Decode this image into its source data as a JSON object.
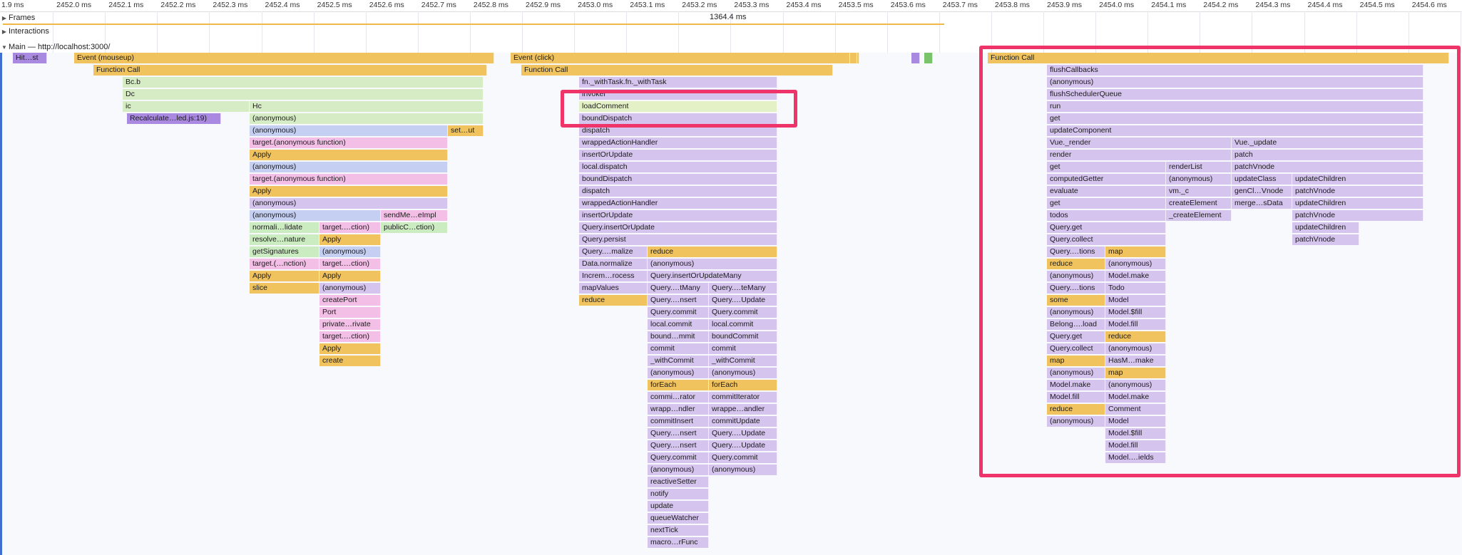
{
  "ruler": {
    "ticks": [
      "1.9 ms",
      "2452.0 ms",
      "2452.1 ms",
      "2452.2 ms",
      "2452.3 ms",
      "2452.4 ms",
      "2452.5 ms",
      "2452.6 ms",
      "2452.7 ms",
      "2452.8 ms",
      "2452.9 ms",
      "2453.0 ms",
      "2453.1 ms",
      "2453.2 ms",
      "2453.3 ms",
      "2453.4 ms",
      "2453.5 ms",
      "2453.6 ms",
      "2453.7 ms",
      "2453.8 ms",
      "2453.9 ms",
      "2454.0 ms",
      "2454.1 ms",
      "2454.2 ms",
      "2454.3 ms",
      "2454.4 ms",
      "2454.5 ms",
      "2454.6 ms",
      "24"
    ]
  },
  "tracks": {
    "frames": "Frames",
    "interactions": "Interactions",
    "main": "Main — http://localhost:3000/",
    "total": "1364.4 ms"
  },
  "colors": {
    "yellow": "#f0c35e",
    "green": "#d6ecc4",
    "purple": "#d5c4ee",
    "dark_purple": "#a98ae0",
    "pink": "#f3bfe6",
    "blue": "#c4cff2",
    "highlight": "#ee3468"
  },
  "flame": [
    {
      "row": 0,
      "s": 18,
      "e": 66,
      "c": "dp",
      "t": "Hit…st"
    },
    {
      "row": 0,
      "s": 104,
      "e": 693,
      "c": "y",
      "t": "Event (mouseup)"
    },
    {
      "row": 1,
      "s": 131,
      "e": 683,
      "c": "y",
      "t": "Function Call"
    },
    {
      "row": 2,
      "s": 172,
      "e": 678,
      "c": "g",
      "t": "Bc.b"
    },
    {
      "row": 3,
      "s": 172,
      "e": 678,
      "c": "g",
      "t": "Dc"
    },
    {
      "row": 4,
      "s": 172,
      "e": 350,
      "c": "g",
      "t": "ic"
    },
    {
      "row": 4,
      "s": 350,
      "e": 678,
      "c": "g",
      "t": "Hc"
    },
    {
      "row": 5,
      "s": 178,
      "e": 310,
      "c": "dp",
      "t": "Recalculate…led.js:19)"
    },
    {
      "row": 5,
      "s": 350,
      "e": 678,
      "c": "g",
      "t": "(anonymous)"
    },
    {
      "row": 6,
      "s": 350,
      "e": 628,
      "c": "b",
      "t": "(anonymous)"
    },
    {
      "row": 6,
      "s": 628,
      "e": 678,
      "c": "y",
      "t": "set…ut"
    },
    {
      "row": 7,
      "s": 350,
      "e": 628,
      "c": "pk",
      "t": "target.(anonymous function)"
    },
    {
      "row": 8,
      "s": 350,
      "e": 628,
      "c": "y",
      "t": "Apply"
    },
    {
      "row": 9,
      "s": 350,
      "e": 628,
      "c": "b",
      "t": "(anonymous)"
    },
    {
      "row": 10,
      "s": 350,
      "e": 628,
      "c": "pk",
      "t": "target.(anonymous function)"
    },
    {
      "row": 11,
      "s": 350,
      "e": 628,
      "c": "y",
      "t": "Apply"
    },
    {
      "row": 12,
      "s": 350,
      "e": 628,
      "c": "p",
      "t": "(anonymous)"
    },
    {
      "row": 13,
      "s": 350,
      "e": 534,
      "c": "b",
      "t": "(anonymous)"
    },
    {
      "row": 13,
      "s": 534,
      "e": 628,
      "c": "pk",
      "t": "sendMe…eImpl"
    },
    {
      "row": 14,
      "s": 350,
      "e": 448,
      "c": "lg",
      "t": "normali…lidate"
    },
    {
      "row": 14,
      "s": 448,
      "e": 534,
      "c": "pk",
      "t": "target.…ction)"
    },
    {
      "row": 14,
      "s": 534,
      "e": 628,
      "c": "lg",
      "t": "publicC…ction)"
    },
    {
      "row": 15,
      "s": 350,
      "e": 448,
      "c": "lg",
      "t": "resolve…nature"
    },
    {
      "row": 15,
      "s": 448,
      "e": 534,
      "c": "y",
      "t": "Apply"
    },
    {
      "row": 16,
      "s": 350,
      "e": 448,
      "c": "lg",
      "t": "getSignatures"
    },
    {
      "row": 16,
      "s": 448,
      "e": 534,
      "c": "b",
      "t": "(anonymous)"
    },
    {
      "row": 17,
      "s": 350,
      "e": 448,
      "c": "pk",
      "t": "target.(…nction)"
    },
    {
      "row": 17,
      "s": 448,
      "e": 534,
      "c": "pk",
      "t": "target.…ction)"
    },
    {
      "row": 18,
      "s": 350,
      "e": 448,
      "c": "y",
      "t": "Apply"
    },
    {
      "row": 18,
      "s": 448,
      "e": 534,
      "c": "y",
      "t": "Apply"
    },
    {
      "row": 19,
      "s": 350,
      "e": 448,
      "c": "y",
      "t": "slice"
    },
    {
      "row": 19,
      "s": 448,
      "e": 534,
      "c": "p",
      "t": "(anonymous)"
    },
    {
      "row": 20,
      "s": 448,
      "e": 534,
      "c": "pk",
      "t": "createPort"
    },
    {
      "row": 21,
      "s": 448,
      "e": 534,
      "c": "pk",
      "t": "Port"
    },
    {
      "row": 22,
      "s": 448,
      "e": 534,
      "c": "pk",
      "t": "private…rivate"
    },
    {
      "row": 23,
      "s": 448,
      "e": 534,
      "c": "pk",
      "t": "target.…ction)"
    },
    {
      "row": 24,
      "s": 448,
      "e": 534,
      "c": "y",
      "t": "Apply"
    },
    {
      "row": 25,
      "s": 448,
      "e": 534,
      "c": "y",
      "t": "create"
    },
    {
      "row": 0,
      "s": 716,
      "e": 1205,
      "c": "y",
      "t": "Event (click)"
    },
    {
      "row": 1,
      "s": 731,
      "e": 1168,
      "c": "y",
      "t": "Function Call"
    },
    {
      "row": 2,
      "s": 812,
      "e": 1090,
      "c": "p",
      "t": "fn._withTask.fn._withTask"
    },
    {
      "row": 3,
      "s": 812,
      "e": 1090,
      "c": "p",
      "t": "invoker"
    },
    {
      "row": 4,
      "s": 812,
      "e": 1090,
      "c": "hl",
      "t": "loadComment"
    },
    {
      "row": 5,
      "s": 812,
      "e": 1090,
      "c": "p",
      "t": "boundDispatch"
    },
    {
      "row": 6,
      "s": 812,
      "e": 1090,
      "c": "p",
      "t": "dispatch"
    },
    {
      "row": 7,
      "s": 812,
      "e": 1090,
      "c": "p",
      "t": "wrappedActionHandler"
    },
    {
      "row": 8,
      "s": 812,
      "e": 1090,
      "c": "p",
      "t": "insertOrUpdate"
    },
    {
      "row": 9,
      "s": 812,
      "e": 1090,
      "c": "p",
      "t": "local.dispatch"
    },
    {
      "row": 10,
      "s": 812,
      "e": 1090,
      "c": "p",
      "t": "boundDispatch"
    },
    {
      "row": 11,
      "s": 812,
      "e": 1090,
      "c": "p",
      "t": "dispatch"
    },
    {
      "row": 12,
      "s": 812,
      "e": 1090,
      "c": "p",
      "t": "wrappedActionHandler"
    },
    {
      "row": 13,
      "s": 812,
      "e": 1090,
      "c": "p",
      "t": "insertOrUpdate"
    },
    {
      "row": 14,
      "s": 812,
      "e": 1090,
      "c": "p",
      "t": "Query.insertOrUpdate"
    },
    {
      "row": 15,
      "s": 812,
      "e": 1090,
      "c": "p",
      "t": "Query.persist"
    },
    {
      "row": 16,
      "s": 812,
      "e": 908,
      "c": "p",
      "t": "Query.…malize"
    },
    {
      "row": 16,
      "s": 908,
      "e": 1090,
      "c": "y",
      "t": "reduce"
    },
    {
      "row": 17,
      "s": 812,
      "e": 908,
      "c": "p",
      "t": "Data.normalize"
    },
    {
      "row": 17,
      "s": 908,
      "e": 1090,
      "c": "p",
      "t": "(anonymous)"
    },
    {
      "row": 18,
      "s": 812,
      "e": 908,
      "c": "p",
      "t": "Increm…rocess"
    },
    {
      "row": 18,
      "s": 908,
      "e": 1090,
      "c": "p",
      "t": "Query.insertOrUpdateMany"
    },
    {
      "row": 19,
      "s": 812,
      "e": 908,
      "c": "p",
      "t": "mapValues"
    },
    {
      "row": 19,
      "s": 908,
      "e": 994,
      "c": "p",
      "t": "Query.…tMany"
    },
    {
      "row": 19,
      "s": 994,
      "e": 1090,
      "c": "p",
      "t": "Query.…teMany"
    },
    {
      "row": 20,
      "s": 812,
      "e": 908,
      "c": "y",
      "t": "reduce"
    },
    {
      "row": 20,
      "s": 908,
      "e": 994,
      "c": "p",
      "t": "Query.…nsert"
    },
    {
      "row": 20,
      "s": 994,
      "e": 1090,
      "c": "p",
      "t": "Query.…Update"
    },
    {
      "row": 21,
      "s": 908,
      "e": 994,
      "c": "p",
      "t": "Query.commit"
    },
    {
      "row": 21,
      "s": 994,
      "e": 1090,
      "c": "p",
      "t": "Query.commit"
    },
    {
      "row": 22,
      "s": 908,
      "e": 994,
      "c": "p",
      "t": "local.commit"
    },
    {
      "row": 22,
      "s": 994,
      "e": 1090,
      "c": "p",
      "t": "local.commit"
    },
    {
      "row": 23,
      "s": 908,
      "e": 994,
      "c": "p",
      "t": "bound…mmit"
    },
    {
      "row": 23,
      "s": 994,
      "e": 1090,
      "c": "p",
      "t": "boundCommit"
    },
    {
      "row": 24,
      "s": 908,
      "e": 994,
      "c": "p",
      "t": "commit"
    },
    {
      "row": 24,
      "s": 994,
      "e": 1090,
      "c": "p",
      "t": "commit"
    },
    {
      "row": 25,
      "s": 908,
      "e": 994,
      "c": "p",
      "t": "_withCommit"
    },
    {
      "row": 25,
      "s": 994,
      "e": 1090,
      "c": "p",
      "t": "_withCommit"
    },
    {
      "row": 26,
      "s": 908,
      "e": 994,
      "c": "p",
      "t": "(anonymous)"
    },
    {
      "row": 26,
      "s": 994,
      "e": 1090,
      "c": "p",
      "t": "(anonymous)"
    },
    {
      "row": 27,
      "s": 908,
      "e": 994,
      "c": "y",
      "t": "forEach"
    },
    {
      "row": 27,
      "s": 994,
      "e": 1090,
      "c": "y",
      "t": "forEach"
    },
    {
      "row": 28,
      "s": 908,
      "e": 994,
      "c": "p",
      "t": "commi…rator"
    },
    {
      "row": 28,
      "s": 994,
      "e": 1090,
      "c": "p",
      "t": "commitIterator"
    },
    {
      "row": 29,
      "s": 908,
      "e": 994,
      "c": "p",
      "t": "wrapp…ndler"
    },
    {
      "row": 29,
      "s": 994,
      "e": 1090,
      "c": "p",
      "t": "wrappe…andler"
    },
    {
      "row": 30,
      "s": 908,
      "e": 994,
      "c": "p",
      "t": "commitInsert"
    },
    {
      "row": 30,
      "s": 994,
      "e": 1090,
      "c": "p",
      "t": "commitUpdate"
    },
    {
      "row": 31,
      "s": 908,
      "e": 994,
      "c": "p",
      "t": "Query.…nsert"
    },
    {
      "row": 31,
      "s": 994,
      "e": 1090,
      "c": "p",
      "t": "Query.…Update"
    },
    {
      "row": 32,
      "s": 908,
      "e": 994,
      "c": "p",
      "t": "Query.…nsert"
    },
    {
      "row": 32,
      "s": 994,
      "e": 1090,
      "c": "p",
      "t": "Query.…Update"
    },
    {
      "row": 33,
      "s": 908,
      "e": 994,
      "c": "p",
      "t": "Query.commit"
    },
    {
      "row": 33,
      "s": 994,
      "e": 1090,
      "c": "p",
      "t": "Query.commit"
    },
    {
      "row": 34,
      "s": 908,
      "e": 994,
      "c": "p",
      "t": "(anonymous)"
    },
    {
      "row": 34,
      "s": 994,
      "e": 1090,
      "c": "p",
      "t": "(anonymous)"
    },
    {
      "row": 35,
      "s": 908,
      "e": 994,
      "c": "p",
      "t": "reactiveSetter"
    },
    {
      "row": 36,
      "s": 908,
      "e": 994,
      "c": "p",
      "t": "notify"
    },
    {
      "row": 37,
      "s": 908,
      "e": 994,
      "c": "p",
      "t": "update"
    },
    {
      "row": 38,
      "s": 908,
      "e": 994,
      "c": "p",
      "t": "queueWatcher"
    },
    {
      "row": 39,
      "s": 908,
      "e": 994,
      "c": "p",
      "t": "nextTick"
    },
    {
      "row": 40,
      "s": 908,
      "e": 994,
      "c": "p",
      "t": "macro…rFunc"
    },
    {
      "row": 0,
      "s": 1278,
      "e": 1290,
      "c": "dp",
      "t": ""
    },
    {
      "row": 0,
      "s": 1296,
      "e": 1308,
      "c": "gr",
      "t": ""
    },
    {
      "row": 0,
      "s": 1188,
      "e": 1192,
      "c": "y",
      "t": ""
    },
    {
      "row": 0,
      "s": 1198,
      "e": 1202,
      "c": "y",
      "t": ""
    },
    {
      "row": 0,
      "s": 1385,
      "e": 2032,
      "c": "y",
      "t": "Function Call"
    },
    {
      "row": 1,
      "s": 1468,
      "e": 1996,
      "c": "p",
      "t": "flushCallbacks"
    },
    {
      "row": 2,
      "s": 1468,
      "e": 1996,
      "c": "p",
      "t": "(anonymous)"
    },
    {
      "row": 3,
      "s": 1468,
      "e": 1996,
      "c": "p",
      "t": "flushSchedulerQueue"
    },
    {
      "row": 4,
      "s": 1468,
      "e": 1996,
      "c": "p",
      "t": "run"
    },
    {
      "row": 5,
      "s": 1468,
      "e": 1996,
      "c": "p",
      "t": "get"
    },
    {
      "row": 6,
      "s": 1468,
      "e": 1996,
      "c": "p",
      "t": "updateComponent"
    },
    {
      "row": 7,
      "s": 1468,
      "e": 1727,
      "c": "p",
      "t": "Vue._render"
    },
    {
      "row": 7,
      "s": 1727,
      "e": 1996,
      "c": "p",
      "t": "Vue._update"
    },
    {
      "row": 8,
      "s": 1468,
      "e": 1727,
      "c": "p",
      "t": "render"
    },
    {
      "row": 8,
      "s": 1727,
      "e": 1996,
      "c": "p",
      "t": "patch"
    },
    {
      "row": 9,
      "s": 1468,
      "e": 1635,
      "c": "p",
      "t": "get"
    },
    {
      "row": 9,
      "s": 1635,
      "e": 1727,
      "c": "p",
      "t": "renderList"
    },
    {
      "row": 9,
      "s": 1727,
      "e": 1996,
      "c": "p",
      "t": "patchVnode"
    },
    {
      "row": 10,
      "s": 1468,
      "e": 1635,
      "c": "p",
      "t": "computedGetter"
    },
    {
      "row": 10,
      "s": 1635,
      "e": 1727,
      "c": "p",
      "t": "(anonymous)"
    },
    {
      "row": 10,
      "s": 1727,
      "e": 1812,
      "c": "p",
      "t": "updateClass"
    },
    {
      "row": 10,
      "s": 1812,
      "e": 1996,
      "c": "p",
      "t": "updateChildren"
    },
    {
      "row": 11,
      "s": 1468,
      "e": 1635,
      "c": "p",
      "t": "evaluate"
    },
    {
      "row": 11,
      "s": 1635,
      "e": 1727,
      "c": "p",
      "t": "vm._c"
    },
    {
      "row": 11,
      "s": 1727,
      "e": 1812,
      "c": "p",
      "t": "genCl…Vnode"
    },
    {
      "row": 11,
      "s": 1812,
      "e": 1996,
      "c": "p",
      "t": "patchVnode"
    },
    {
      "row": 12,
      "s": 1468,
      "e": 1635,
      "c": "p",
      "t": "get"
    },
    {
      "row": 12,
      "s": 1635,
      "e": 1727,
      "c": "p",
      "t": "createElement"
    },
    {
      "row": 12,
      "s": 1727,
      "e": 1812,
      "c": "p",
      "t": "merge…sData"
    },
    {
      "row": 12,
      "s": 1812,
      "e": 1996,
      "c": "p",
      "t": "updateChildren"
    },
    {
      "row": 13,
      "s": 1468,
      "e": 1635,
      "c": "p",
      "t": "todos"
    },
    {
      "row": 13,
      "s": 1635,
      "e": 1727,
      "c": "p",
      "t": "_createElement"
    },
    {
      "row": 13,
      "s": 1812,
      "e": 1996,
      "c": "p",
      "t": "patchVnode"
    },
    {
      "row": 14,
      "s": 1468,
      "e": 1635,
      "c": "p",
      "t": "Query.get"
    },
    {
      "row": 14,
      "s": 1812,
      "e": 1906,
      "c": "p",
      "t": "updateChildren"
    },
    {
      "row": 15,
      "s": 1468,
      "e": 1635,
      "c": "p",
      "t": "Query.collect"
    },
    {
      "row": 15,
      "s": 1812,
      "e": 1906,
      "c": "p",
      "t": "patchVnode"
    },
    {
      "row": 16,
      "s": 1468,
      "e": 1550,
      "c": "p",
      "t": "Query.…tions"
    },
    {
      "row": 16,
      "s": 1550,
      "e": 1635,
      "c": "y",
      "t": "map"
    },
    {
      "row": 17,
      "s": 1468,
      "e": 1550,
      "c": "y",
      "t": "reduce"
    },
    {
      "row": 17,
      "s": 1550,
      "e": 1635,
      "c": "p",
      "t": "(anonymous)"
    },
    {
      "row": 18,
      "s": 1468,
      "e": 1550,
      "c": "p",
      "t": "(anonymous)"
    },
    {
      "row": 18,
      "s": 1550,
      "e": 1635,
      "c": "p",
      "t": "Model.make"
    },
    {
      "row": 19,
      "s": 1468,
      "e": 1550,
      "c": "p",
      "t": "Query.…tions"
    },
    {
      "row": 19,
      "s": 1550,
      "e": 1635,
      "c": "p",
      "t": "Todo"
    },
    {
      "row": 20,
      "s": 1468,
      "e": 1550,
      "c": "y",
      "t": "some"
    },
    {
      "row": 20,
      "s": 1550,
      "e": 1635,
      "c": "p",
      "t": "Model"
    },
    {
      "row": 21,
      "s": 1468,
      "e": 1550,
      "c": "p",
      "t": "(anonymous)"
    },
    {
      "row": 21,
      "s": 1550,
      "e": 1635,
      "c": "p",
      "t": "Model.$fill"
    },
    {
      "row": 22,
      "s": 1468,
      "e": 1550,
      "c": "p",
      "t": "Belong….load"
    },
    {
      "row": 22,
      "s": 1550,
      "e": 1635,
      "c": "p",
      "t": "Model.fill"
    },
    {
      "row": 23,
      "s": 1468,
      "e": 1550,
      "c": "p",
      "t": "Query.get"
    },
    {
      "row": 23,
      "s": 1550,
      "e": 1635,
      "c": "y",
      "t": "reduce"
    },
    {
      "row": 24,
      "s": 1468,
      "e": 1550,
      "c": "p",
      "t": "Query.collect"
    },
    {
      "row": 24,
      "s": 1550,
      "e": 1635,
      "c": "p",
      "t": "(anonymous)"
    },
    {
      "row": 25,
      "s": 1468,
      "e": 1550,
      "c": "y",
      "t": "map"
    },
    {
      "row": 25,
      "s": 1550,
      "e": 1635,
      "c": "p",
      "t": "HasM…make"
    },
    {
      "row": 26,
      "s": 1468,
      "e": 1550,
      "c": "p",
      "t": "(anonymous)"
    },
    {
      "row": 26,
      "s": 1550,
      "e": 1635,
      "c": "y",
      "t": "map"
    },
    {
      "row": 27,
      "s": 1468,
      "e": 1550,
      "c": "p",
      "t": "Model.make"
    },
    {
      "row": 27,
      "s": 1550,
      "e": 1635,
      "c": "p",
      "t": "(anonymous)"
    },
    {
      "row": 28,
      "s": 1468,
      "e": 1550,
      "c": "p",
      "t": "Model.fill"
    },
    {
      "row": 28,
      "s": 1550,
      "e": 1635,
      "c": "p",
      "t": "Model.make"
    },
    {
      "row": 29,
      "s": 1468,
      "e": 1550,
      "c": "y",
      "t": "reduce"
    },
    {
      "row": 29,
      "s": 1550,
      "e": 1635,
      "c": "p",
      "t": "Comment"
    },
    {
      "row": 30,
      "s": 1468,
      "e": 1550,
      "c": "p",
      "t": "(anonymous)"
    },
    {
      "row": 30,
      "s": 1550,
      "e": 1635,
      "c": "p",
      "t": "Model"
    },
    {
      "row": 31,
      "s": 1550,
      "e": 1635,
      "c": "p",
      "t": "Model.$fill"
    },
    {
      "row": 32,
      "s": 1550,
      "e": 1635,
      "c": "p",
      "t": "Model.fill"
    },
    {
      "row": 33,
      "s": 1550,
      "e": 1635,
      "c": "p",
      "t": "Model.…ields"
    }
  ]
}
